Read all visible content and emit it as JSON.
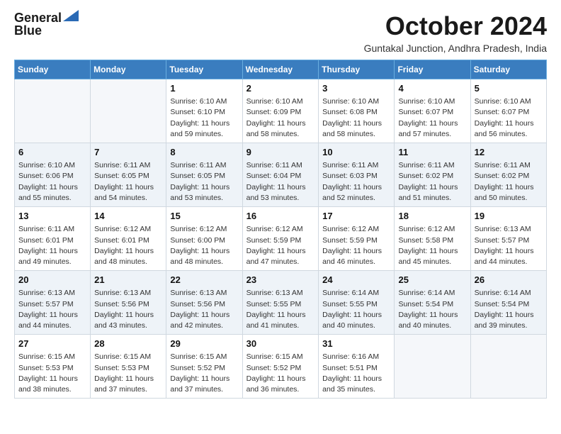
{
  "logo": {
    "line1": "General",
    "line2": "Blue"
  },
  "title": "October 2024",
  "subtitle": "Guntakal Junction, Andhra Pradesh, India",
  "weekdays": [
    "Sunday",
    "Monday",
    "Tuesday",
    "Wednesday",
    "Thursday",
    "Friday",
    "Saturday"
  ],
  "weeks": [
    [
      {
        "day": "",
        "sunrise": "",
        "sunset": "",
        "daylight": ""
      },
      {
        "day": "",
        "sunrise": "",
        "sunset": "",
        "daylight": ""
      },
      {
        "day": "1",
        "sunrise": "Sunrise: 6:10 AM",
        "sunset": "Sunset: 6:10 PM",
        "daylight": "Daylight: 11 hours and 59 minutes."
      },
      {
        "day": "2",
        "sunrise": "Sunrise: 6:10 AM",
        "sunset": "Sunset: 6:09 PM",
        "daylight": "Daylight: 11 hours and 58 minutes."
      },
      {
        "day": "3",
        "sunrise": "Sunrise: 6:10 AM",
        "sunset": "Sunset: 6:08 PM",
        "daylight": "Daylight: 11 hours and 58 minutes."
      },
      {
        "day": "4",
        "sunrise": "Sunrise: 6:10 AM",
        "sunset": "Sunset: 6:07 PM",
        "daylight": "Daylight: 11 hours and 57 minutes."
      },
      {
        "day": "5",
        "sunrise": "Sunrise: 6:10 AM",
        "sunset": "Sunset: 6:07 PM",
        "daylight": "Daylight: 11 hours and 56 minutes."
      }
    ],
    [
      {
        "day": "6",
        "sunrise": "Sunrise: 6:10 AM",
        "sunset": "Sunset: 6:06 PM",
        "daylight": "Daylight: 11 hours and 55 minutes."
      },
      {
        "day": "7",
        "sunrise": "Sunrise: 6:11 AM",
        "sunset": "Sunset: 6:05 PM",
        "daylight": "Daylight: 11 hours and 54 minutes."
      },
      {
        "day": "8",
        "sunrise": "Sunrise: 6:11 AM",
        "sunset": "Sunset: 6:05 PM",
        "daylight": "Daylight: 11 hours and 53 minutes."
      },
      {
        "day": "9",
        "sunrise": "Sunrise: 6:11 AM",
        "sunset": "Sunset: 6:04 PM",
        "daylight": "Daylight: 11 hours and 53 minutes."
      },
      {
        "day": "10",
        "sunrise": "Sunrise: 6:11 AM",
        "sunset": "Sunset: 6:03 PM",
        "daylight": "Daylight: 11 hours and 52 minutes."
      },
      {
        "day": "11",
        "sunrise": "Sunrise: 6:11 AM",
        "sunset": "Sunset: 6:02 PM",
        "daylight": "Daylight: 11 hours and 51 minutes."
      },
      {
        "day": "12",
        "sunrise": "Sunrise: 6:11 AM",
        "sunset": "Sunset: 6:02 PM",
        "daylight": "Daylight: 11 hours and 50 minutes."
      }
    ],
    [
      {
        "day": "13",
        "sunrise": "Sunrise: 6:11 AM",
        "sunset": "Sunset: 6:01 PM",
        "daylight": "Daylight: 11 hours and 49 minutes."
      },
      {
        "day": "14",
        "sunrise": "Sunrise: 6:12 AM",
        "sunset": "Sunset: 6:01 PM",
        "daylight": "Daylight: 11 hours and 48 minutes."
      },
      {
        "day": "15",
        "sunrise": "Sunrise: 6:12 AM",
        "sunset": "Sunset: 6:00 PM",
        "daylight": "Daylight: 11 hours and 48 minutes."
      },
      {
        "day": "16",
        "sunrise": "Sunrise: 6:12 AM",
        "sunset": "Sunset: 5:59 PM",
        "daylight": "Daylight: 11 hours and 47 minutes."
      },
      {
        "day": "17",
        "sunrise": "Sunrise: 6:12 AM",
        "sunset": "Sunset: 5:59 PM",
        "daylight": "Daylight: 11 hours and 46 minutes."
      },
      {
        "day": "18",
        "sunrise": "Sunrise: 6:12 AM",
        "sunset": "Sunset: 5:58 PM",
        "daylight": "Daylight: 11 hours and 45 minutes."
      },
      {
        "day": "19",
        "sunrise": "Sunrise: 6:13 AM",
        "sunset": "Sunset: 5:57 PM",
        "daylight": "Daylight: 11 hours and 44 minutes."
      }
    ],
    [
      {
        "day": "20",
        "sunrise": "Sunrise: 6:13 AM",
        "sunset": "Sunset: 5:57 PM",
        "daylight": "Daylight: 11 hours and 44 minutes."
      },
      {
        "day": "21",
        "sunrise": "Sunrise: 6:13 AM",
        "sunset": "Sunset: 5:56 PM",
        "daylight": "Daylight: 11 hours and 43 minutes."
      },
      {
        "day": "22",
        "sunrise": "Sunrise: 6:13 AM",
        "sunset": "Sunset: 5:56 PM",
        "daylight": "Daylight: 11 hours and 42 minutes."
      },
      {
        "day": "23",
        "sunrise": "Sunrise: 6:13 AM",
        "sunset": "Sunset: 5:55 PM",
        "daylight": "Daylight: 11 hours and 41 minutes."
      },
      {
        "day": "24",
        "sunrise": "Sunrise: 6:14 AM",
        "sunset": "Sunset: 5:55 PM",
        "daylight": "Daylight: 11 hours and 40 minutes."
      },
      {
        "day": "25",
        "sunrise": "Sunrise: 6:14 AM",
        "sunset": "Sunset: 5:54 PM",
        "daylight": "Daylight: 11 hours and 40 minutes."
      },
      {
        "day": "26",
        "sunrise": "Sunrise: 6:14 AM",
        "sunset": "Sunset: 5:54 PM",
        "daylight": "Daylight: 11 hours and 39 minutes."
      }
    ],
    [
      {
        "day": "27",
        "sunrise": "Sunrise: 6:15 AM",
        "sunset": "Sunset: 5:53 PM",
        "daylight": "Daylight: 11 hours and 38 minutes."
      },
      {
        "day": "28",
        "sunrise": "Sunrise: 6:15 AM",
        "sunset": "Sunset: 5:53 PM",
        "daylight": "Daylight: 11 hours and 37 minutes."
      },
      {
        "day": "29",
        "sunrise": "Sunrise: 6:15 AM",
        "sunset": "Sunset: 5:52 PM",
        "daylight": "Daylight: 11 hours and 37 minutes."
      },
      {
        "day": "30",
        "sunrise": "Sunrise: 6:15 AM",
        "sunset": "Sunset: 5:52 PM",
        "daylight": "Daylight: 11 hours and 36 minutes."
      },
      {
        "day": "31",
        "sunrise": "Sunrise: 6:16 AM",
        "sunset": "Sunset: 5:51 PM",
        "daylight": "Daylight: 11 hours and 35 minutes."
      },
      {
        "day": "",
        "sunrise": "",
        "sunset": "",
        "daylight": ""
      },
      {
        "day": "",
        "sunrise": "",
        "sunset": "",
        "daylight": ""
      }
    ]
  ]
}
